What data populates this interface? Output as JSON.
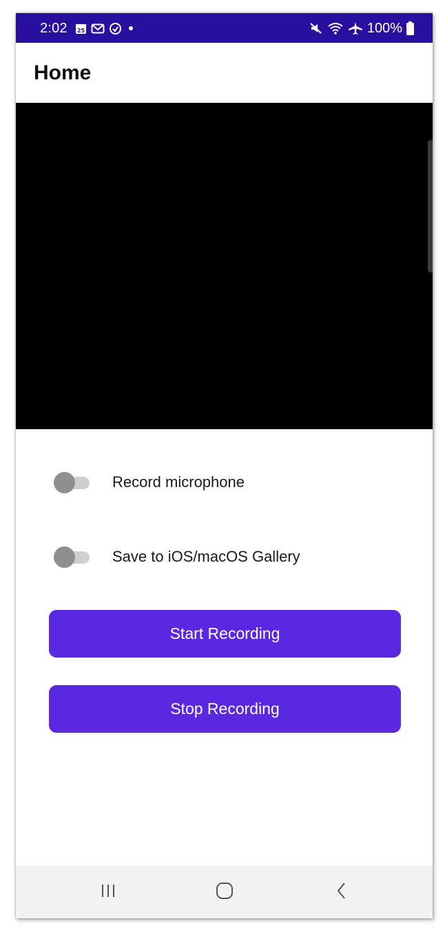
{
  "status_bar": {
    "time": "2:02",
    "battery": "100%",
    "left_icons": [
      "calendar-icon",
      "gmail-icon",
      "sync-icon",
      "dot-icon"
    ],
    "right_icons": [
      "mute-icon",
      "wifi-icon",
      "airplane-icon",
      "battery-icon"
    ],
    "background": "#2a0ea0"
  },
  "header": {
    "title": "Home"
  },
  "options": [
    {
      "label": "Record microphone",
      "checked": false
    },
    {
      "label": "Save to iOS/macOS Gallery",
      "checked": false
    }
  ],
  "buttons": {
    "start_label": "Start Recording",
    "stop_label": "Stop Recording",
    "color": "#5928e0"
  },
  "nav": {
    "items": [
      "recent-apps-icon",
      "home-icon",
      "back-icon"
    ]
  }
}
